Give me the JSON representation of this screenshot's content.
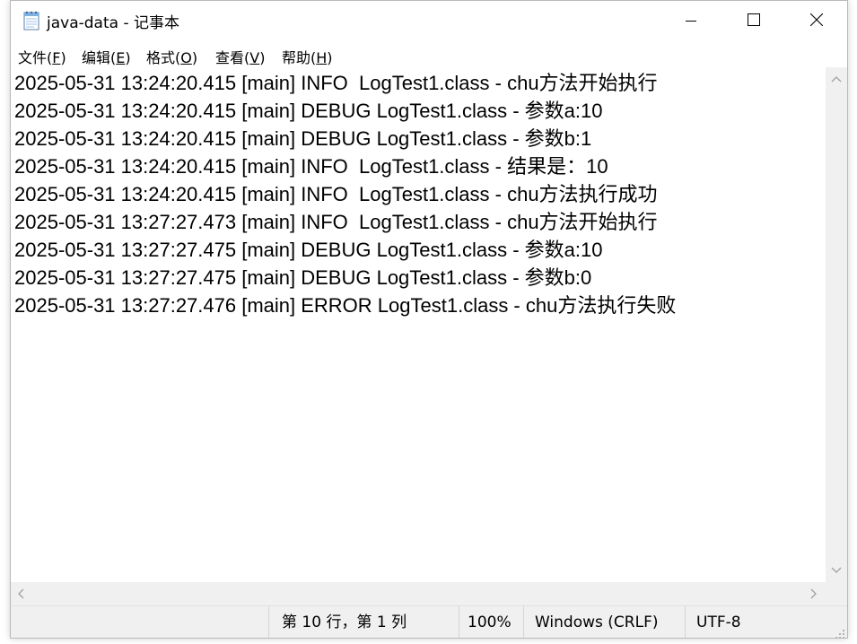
{
  "window": {
    "title": "java-data - 记事本",
    "icon": "notepad-icon",
    "controls": [
      "minimize-icon",
      "maximize-icon",
      "close-icon"
    ]
  },
  "menu": [
    {
      "label": "文件(",
      "accel": "F",
      "end": ")"
    },
    {
      "label": "编辑(",
      "accel": "E",
      "end": ")"
    },
    {
      "label": "格式(",
      "accel": "O",
      "end": ")"
    },
    {
      "label": "查看(",
      "accel": "V",
      "end": ")"
    },
    {
      "label": "帮助(",
      "accel": "H",
      "end": ")"
    }
  ],
  "editor": {
    "lines": [
      "2025-05-31 13:24:20.415 [main] INFO  LogTest1.class - chu方法开始执行",
      "2025-05-31 13:24:20.415 [main] DEBUG LogTest1.class - 参数a:10",
      "2025-05-31 13:24:20.415 [main] DEBUG LogTest1.class - 参数b:1",
      "2025-05-31 13:24:20.415 [main] INFO  LogTest1.class - 结果是：10",
      "2025-05-31 13:24:20.415 [main] INFO  LogTest1.class - chu方法执行成功",
      "2025-05-31 13:27:27.473 [main] INFO  LogTest1.class - chu方法开始执行",
      "2025-05-31 13:27:27.475 [main] DEBUG LogTest1.class - 参数a:10",
      "2025-05-31 13:27:27.475 [main] DEBUG LogTest1.class - 参数b:0",
      "2025-05-31 13:27:27.476 [main] ERROR LogTest1.class - chu方法执行失败"
    ]
  },
  "status": {
    "position": "第 10 行，第 1 列",
    "zoom": "100%",
    "line_ending": "Windows (CRLF)",
    "encoding": "UTF-8"
  },
  "colors": {
    "chrome": "#f0f0f0",
    "text": "#000000",
    "arrow": "#a0a0a0"
  }
}
